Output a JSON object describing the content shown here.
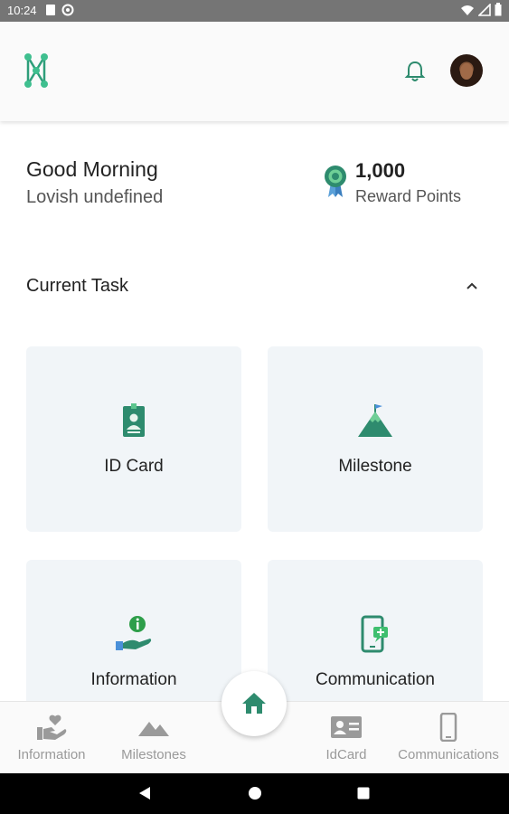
{
  "status_bar": {
    "time": "10:24"
  },
  "header": {
    "notification_icon": "bell-icon",
    "avatar": "user-avatar"
  },
  "greeting": {
    "text": "Good Morning",
    "name": "Lovish undefined"
  },
  "rewards": {
    "points": "1,000",
    "label": "Reward Points"
  },
  "section": {
    "title": "Current Task"
  },
  "cards": [
    {
      "label": "ID Card",
      "icon": "id-card-icon"
    },
    {
      "label": "Milestone",
      "icon": "mountain-flag-icon"
    },
    {
      "label": "Information",
      "icon": "info-hand-icon"
    },
    {
      "label": "Communication",
      "icon": "phone-message-icon"
    }
  ],
  "bottom_nav": [
    {
      "label": "Information",
      "icon": "heart-hand-icon"
    },
    {
      "label": "Milestones",
      "icon": "mountains-icon"
    },
    {
      "label": "IdCard",
      "icon": "contact-card-icon"
    },
    {
      "label": "Communications",
      "icon": "smartphone-icon"
    }
  ],
  "colors": {
    "accent": "#2e8b6e",
    "card_bg": "#f1f5f8",
    "nav_gray": "#9a9a9a"
  }
}
